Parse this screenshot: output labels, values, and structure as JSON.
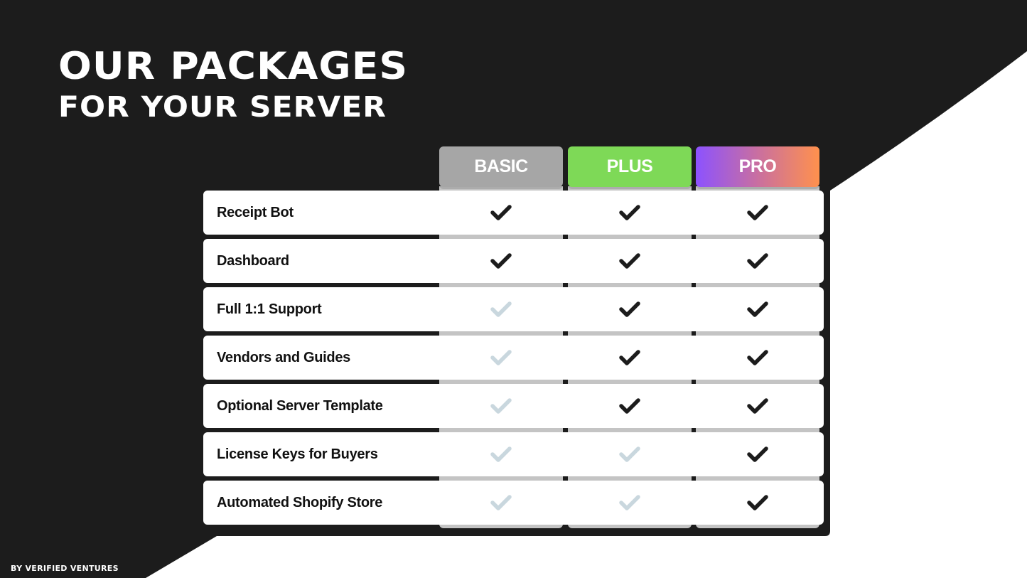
{
  "title": {
    "line1": "OUR PACKAGES",
    "line2": "FOR YOUR SERVER"
  },
  "footer": "BY VERIFIED VENTURES",
  "colors": {
    "background_dark": "#1c1c1c",
    "basic": "#a6a6a6",
    "plus": "#7ed957",
    "pro_gradient_start": "#8c52ff",
    "pro_gradient_end": "#ff914d",
    "check_included": "#1c1c1c",
    "check_excluded": "#c9d7de"
  },
  "plans": [
    {
      "name": "BASIC"
    },
    {
      "name": "PLUS"
    },
    {
      "name": "PRO"
    }
  ],
  "features": [
    {
      "label": "Receipt Bot",
      "included": [
        true,
        true,
        true
      ]
    },
    {
      "label": "Dashboard",
      "included": [
        true,
        true,
        true
      ]
    },
    {
      "label": "Full 1:1 Support",
      "included": [
        false,
        true,
        true
      ]
    },
    {
      "label": "Vendors and Guides",
      "included": [
        false,
        true,
        true
      ]
    },
    {
      "label": "Optional Server Template",
      "included": [
        false,
        true,
        true
      ]
    },
    {
      "label": "License Keys for Buyers",
      "included": [
        false,
        false,
        true
      ]
    },
    {
      "label": "Automated Shopify Store",
      "included": [
        false,
        false,
        true
      ]
    }
  ]
}
